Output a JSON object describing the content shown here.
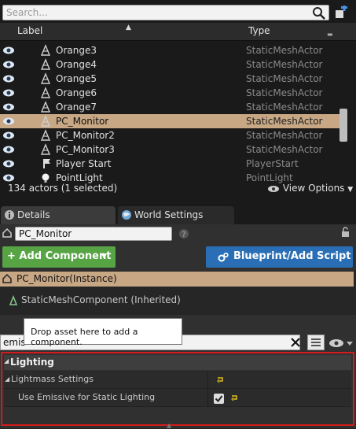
{
  "outliner": {
    "search_placeholder": "Search...",
    "columns": {
      "label": "Label",
      "type": "Type"
    },
    "rows": [
      {
        "name": "Orange3",
        "type": "StaticMeshActor",
        "icon": "static-mesh-icon",
        "selected": false
      },
      {
        "name": "Orange4",
        "type": "StaticMeshActor",
        "icon": "static-mesh-icon",
        "selected": false
      },
      {
        "name": "Orange5",
        "type": "StaticMeshActor",
        "icon": "static-mesh-icon",
        "selected": false
      },
      {
        "name": "Orange6",
        "type": "StaticMeshActor",
        "icon": "static-mesh-icon",
        "selected": false
      },
      {
        "name": "Orange7",
        "type": "StaticMeshActor",
        "icon": "static-mesh-icon",
        "selected": false
      },
      {
        "name": "PC_Monitor",
        "type": "StaticMeshActor",
        "icon": "static-mesh-icon",
        "selected": true
      },
      {
        "name": "PC_Monitor2",
        "type": "StaticMeshActor",
        "icon": "static-mesh-icon",
        "selected": false
      },
      {
        "name": "PC_Monitor3",
        "type": "StaticMeshActor",
        "icon": "static-mesh-icon",
        "selected": false
      },
      {
        "name": "Player Start",
        "type": "PlayerStart",
        "icon": "player-start-icon",
        "selected": false
      },
      {
        "name": "PointLight",
        "type": "PointLight",
        "icon": "point-light-icon",
        "selected": false
      }
    ],
    "status": "134 actors (1 selected)",
    "view_options": "View Options"
  },
  "tabs": [
    {
      "label": "Details",
      "icon": "info-icon"
    },
    {
      "label": "World Settings",
      "icon": "globe-icon"
    }
  ],
  "details": {
    "actor_name": "PC_Monitor",
    "add_component": "+ Add Component",
    "blueprint_button": "Blueprint/Add Script",
    "components": [
      {
        "label": "PC_Monitor(Instance)"
      },
      {
        "label": "StaticMeshComponent (Inherited)"
      }
    ],
    "tooltip": "Drop asset here to add a component.",
    "filter_value": "emis",
    "category": "Lighting",
    "properties": [
      {
        "label": "Lightmass Settings"
      },
      {
        "label": "Use Emissive for Static Lighting",
        "checked": true
      }
    ]
  },
  "colors": {
    "selection": "#c7a784",
    "add_component": "#57a445",
    "blueprint": "#2a6fb5",
    "highlight_frame": "#d51c1c"
  }
}
